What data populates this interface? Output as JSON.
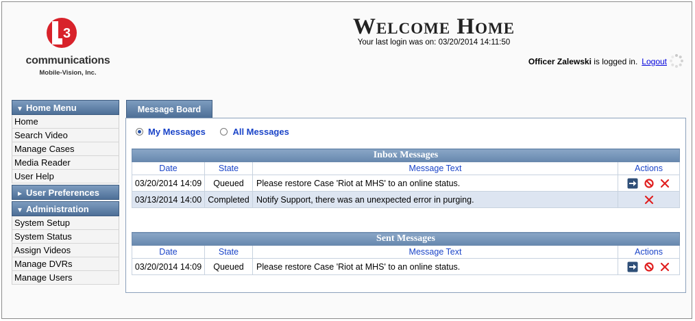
{
  "logo": {
    "company": "communications",
    "division": "Mobile-Vision, Inc.",
    "mark_text": "L3"
  },
  "header": {
    "title": "Welcome Home",
    "last_login": "Your last login was on: 03/20/2014 14:11:50",
    "user_name": "Officer Zalewski",
    "logged_in_text": " is logged in.",
    "logout_label": "Logout"
  },
  "sidebar": {
    "home_menu": {
      "label": "Home Menu",
      "items": [
        "Home",
        "Search Video",
        "Manage Cases",
        "Media Reader",
        "User Help"
      ]
    },
    "user_preferences": {
      "label": "User Preferences"
    },
    "administration": {
      "label": "Administration",
      "items": [
        "System Setup",
        "System Status",
        "Assign Videos",
        "Manage DVRs",
        "Manage Users"
      ]
    }
  },
  "main": {
    "tab_label": "Message Board",
    "filters": {
      "my_messages": "My Messages",
      "all_messages": "All Messages",
      "selected": "my_messages"
    },
    "inbox": {
      "title": "Inbox Messages",
      "columns": [
        "Date",
        "State",
        "Message Text",
        "Actions"
      ],
      "rows": [
        {
          "date": "03/20/2014 14:09",
          "state": "Queued",
          "text": "Please restore Case 'Riot at MHS' to an online status."
        },
        {
          "date": "03/13/2014 14:00",
          "state": "Completed",
          "text": "Notify Support, there was an unexpected error in purging."
        }
      ]
    },
    "sent": {
      "title": "Sent Messages",
      "columns": [
        "Date",
        "State",
        "Message Text",
        "Actions"
      ],
      "rows": [
        {
          "date": "03/20/2014 14:09",
          "state": "Queued",
          "text": "Please restore Case 'Riot at MHS' to an online status."
        }
      ]
    }
  },
  "colors": {
    "menu_header": "#4d6f97",
    "link_blue": "#1a44c8",
    "delete_red": "#e02020",
    "row_alt": "#dde5f1"
  },
  "icons": [
    "forward-arrow-icon",
    "cancel-icon",
    "delete-icon",
    "loading-spinner-icon"
  ]
}
